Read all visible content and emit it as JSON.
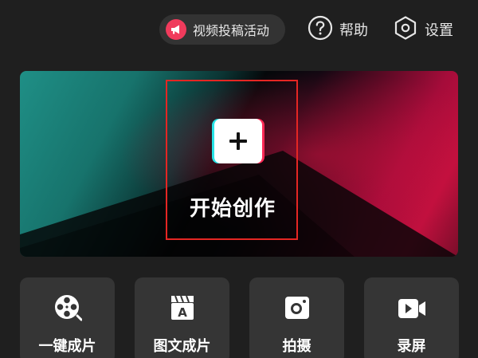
{
  "topbar": {
    "activity_label": "视频投稿活动",
    "activity_icon": "megaphone-icon",
    "help_label": "帮助",
    "help_icon": "question-circle-icon",
    "settings_label": "设置",
    "settings_icon": "hexagon-gear-icon"
  },
  "hero": {
    "title": "开始创作",
    "icon": "plus-icon"
  },
  "tools": [
    {
      "label": "一键成片",
      "icon": "film-reel-icon"
    },
    {
      "label": "图文成片",
      "icon": "text-clapboard-icon"
    },
    {
      "label": "拍摄",
      "icon": "camera-icon"
    },
    {
      "label": "录屏",
      "icon": "screen-record-icon"
    }
  ],
  "colors": {
    "background": "#1f1f1f",
    "tile": "#353535",
    "pill": "#333333",
    "accent_red": "#f03b5c",
    "accent_cyan": "#27e3e6",
    "highlight": "#e52623"
  }
}
